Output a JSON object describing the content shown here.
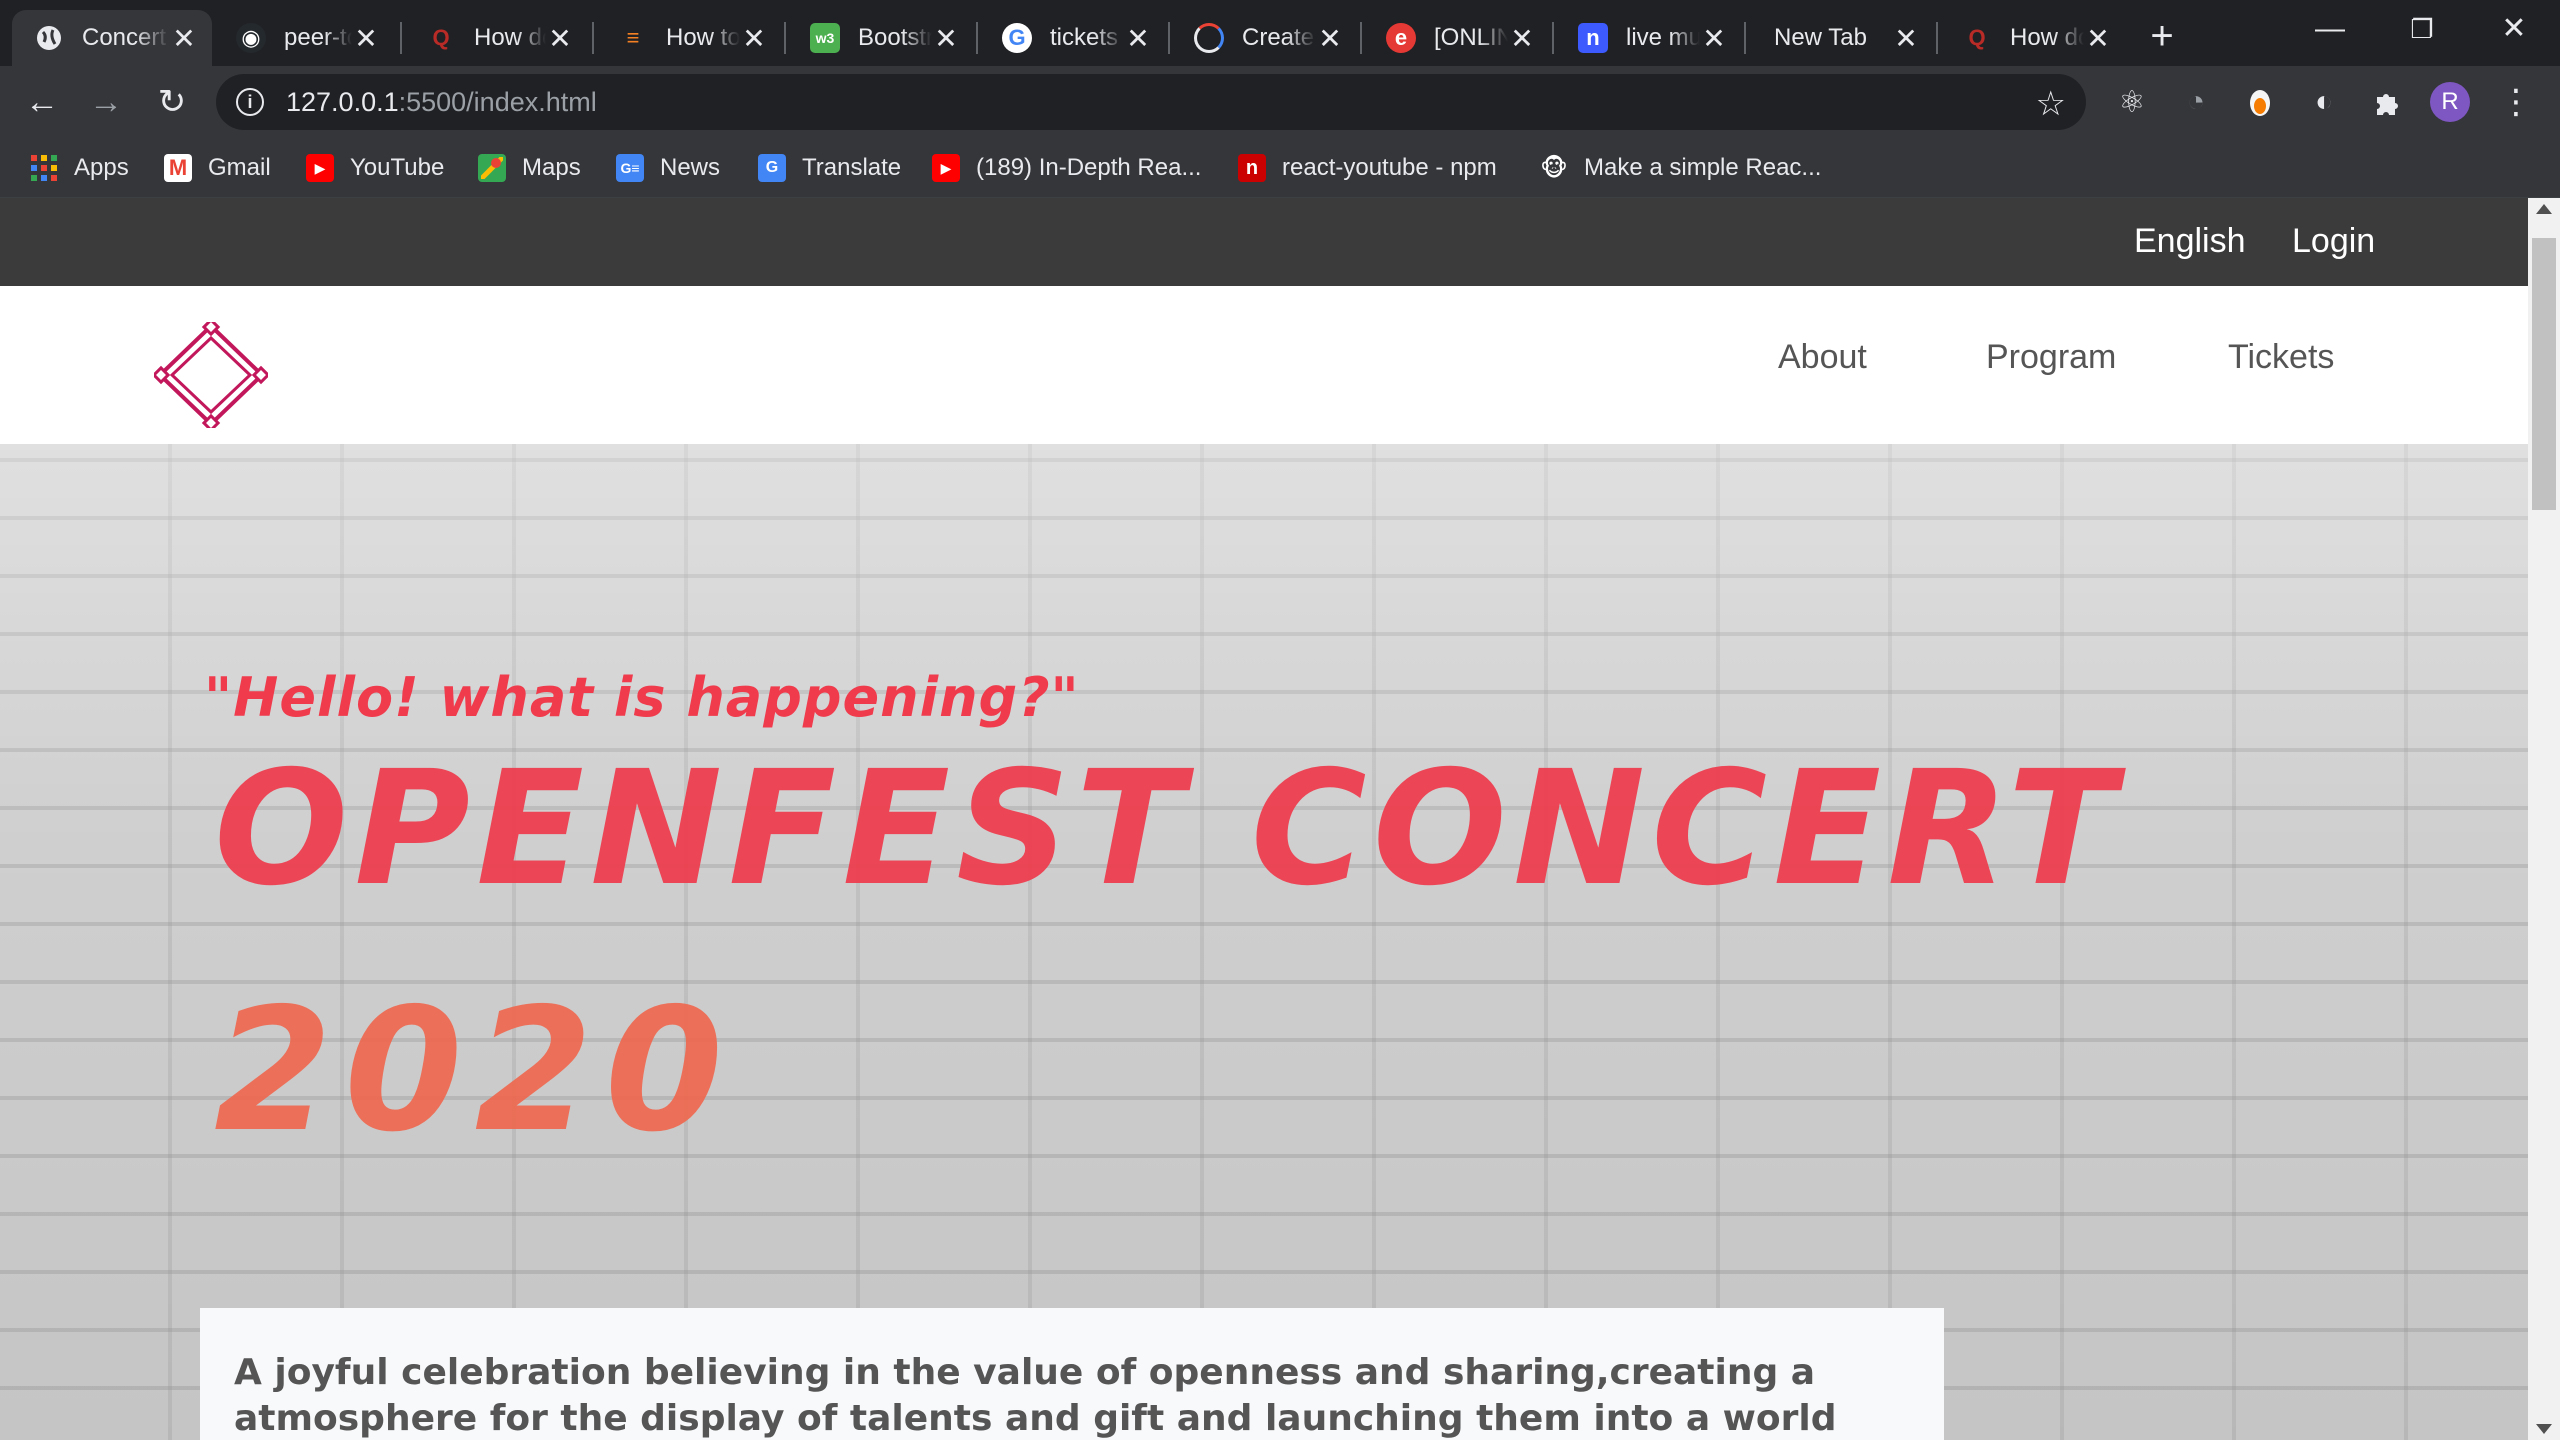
{
  "browser": {
    "tabs": [
      {
        "title": "Concert",
        "favicon": "globe-icon",
        "active": true
      },
      {
        "title": "peer-to-peer",
        "favicon": "github-icon"
      },
      {
        "title": "How do",
        "favicon": "quora-icon"
      },
      {
        "title": "How to",
        "favicon": "stackoverflow-icon"
      },
      {
        "title": "Bootstrap",
        "favicon": "w3schools-icon"
      },
      {
        "title": "tickets",
        "favicon": "google-icon"
      },
      {
        "title": "Create",
        "favicon": "circle-logo-icon"
      },
      {
        "title": "[ONLINE",
        "favicon": "e-icon"
      },
      {
        "title": "live music",
        "favicon": "n-icon"
      },
      {
        "title": "New Tab",
        "favicon": ""
      },
      {
        "title": "How do",
        "favicon": "quora-icon"
      }
    ],
    "address": {
      "host": "127.0.0.1",
      "path": ":5500/index.html"
    },
    "bookmarks": [
      {
        "label": "Apps",
        "icon": "apps-grid-icon"
      },
      {
        "label": "Gmail",
        "icon": "gmail-icon"
      },
      {
        "label": "YouTube",
        "icon": "youtube-icon"
      },
      {
        "label": "Maps",
        "icon": "maps-icon"
      },
      {
        "label": "News",
        "icon": "news-icon"
      },
      {
        "label": "Translate",
        "icon": "translate-icon"
      },
      {
        "label": "(189) In-Depth Rea...",
        "icon": "youtube-icon"
      },
      {
        "label": "react-youtube - npm",
        "icon": "npm-icon"
      },
      {
        "label": "Make a simple Reac...",
        "icon": "monkey-icon"
      }
    ],
    "profile_initial": "R"
  },
  "page": {
    "topbar": {
      "language": "English",
      "login": "Login"
    },
    "nav": {
      "about": "About",
      "program": "Program",
      "tickets": "Tickets"
    },
    "hero": {
      "tagline": "\"Hello! what is happening?\"",
      "headline": "OPENFEST CONCERT",
      "year": "2020",
      "description": "A joyful celebration believing in the value of openness and sharing,creating a atmosphere for the display of talents and gift and launching them into a world full of possibilities."
    },
    "colors": {
      "accent": "#ef3b4c",
      "accent_secondary": "#f0674d",
      "topbar_bg": "#3b3b3b"
    }
  }
}
